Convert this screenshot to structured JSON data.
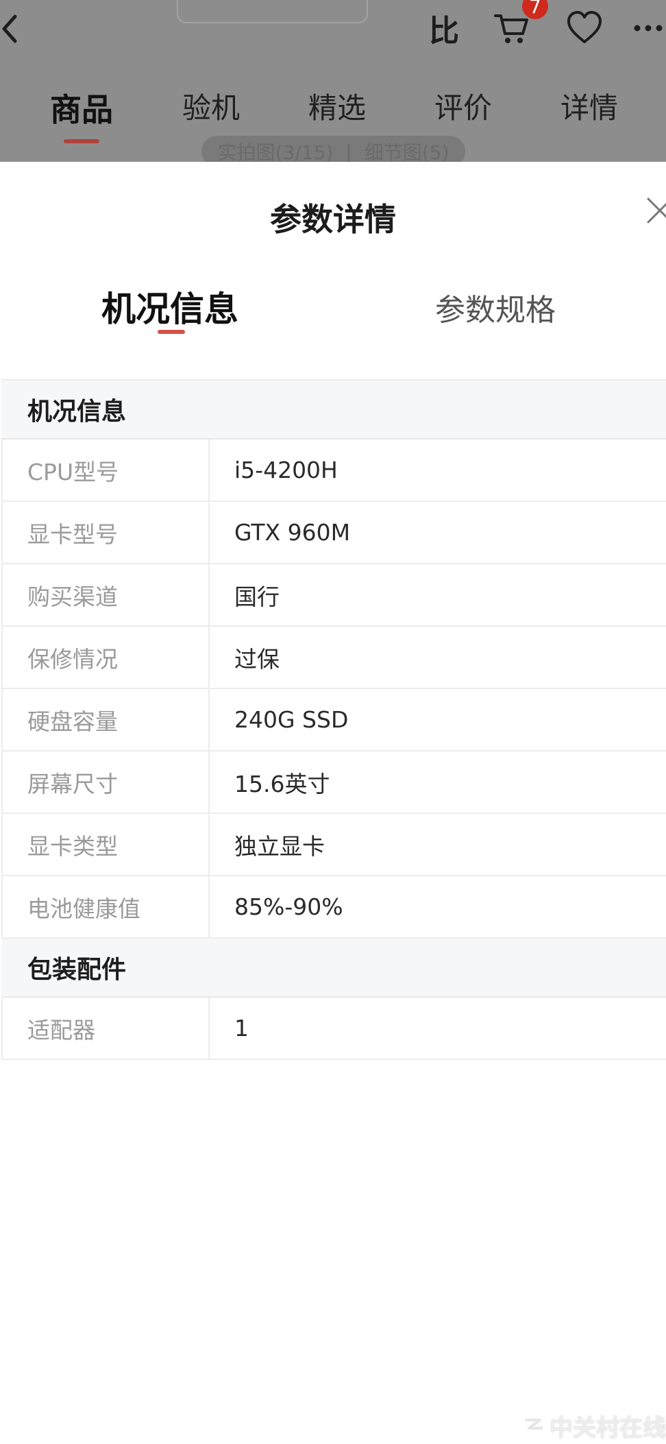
{
  "background_page": {
    "cart_count": "7",
    "compare_label": "比",
    "tabs": [
      "商品",
      "验机",
      "精选",
      "评价",
      "详情"
    ],
    "active_tab": "商品",
    "photo_pill": {
      "real_photos": "实拍图(3/15)",
      "divider": "|",
      "detail_photos": "细节图(5)"
    }
  },
  "sheet": {
    "title": "参数详情",
    "tabs": [
      {
        "label": "机况信息",
        "active": true
      },
      {
        "label": "参数规格",
        "active": false
      }
    ],
    "groups": [
      {
        "title": "机况信息",
        "rows": [
          {
            "label": "CPU型号",
            "value": "i5-4200H"
          },
          {
            "label": "显卡型号",
            "value": "GTX 960M"
          },
          {
            "label": "购买渠道",
            "value": "国行"
          },
          {
            "label": "保修情况",
            "value": "过保"
          },
          {
            "label": "硬盘容量",
            "value": "240G SSD"
          },
          {
            "label": "屏幕尺寸",
            "value": "15.6英寸"
          },
          {
            "label": "显卡类型",
            "value": "独立显卡"
          },
          {
            "label": "电池健康值",
            "value": "85%-90%"
          }
        ]
      },
      {
        "title": "包装配件",
        "rows": [
          {
            "label": "适配器",
            "value": "1"
          }
        ]
      }
    ]
  },
  "watermark": "中关村在线",
  "colors": {
    "accent": "#d45246",
    "badge": "#cf2a1d",
    "overlay": "#8d8d8d"
  }
}
